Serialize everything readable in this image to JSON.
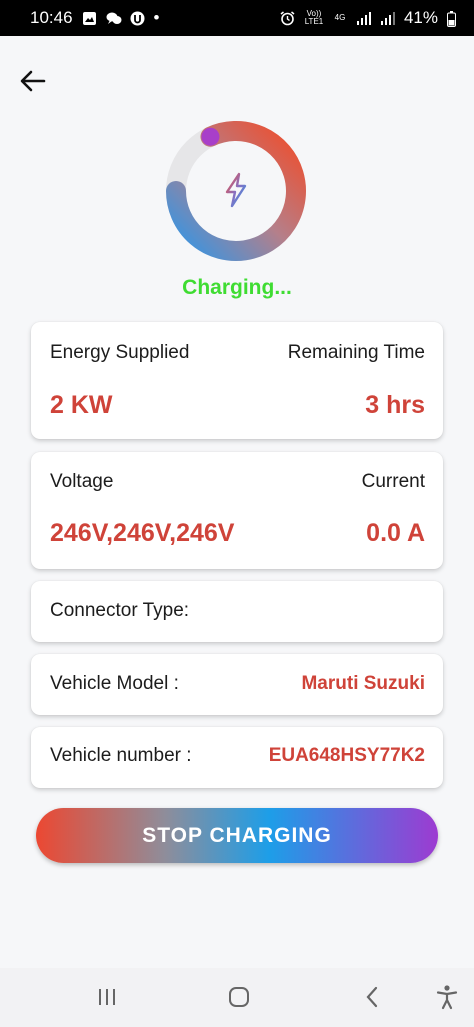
{
  "status_bar": {
    "time": "10:46",
    "dot": "•",
    "volte": "Vo)) LTE1",
    "network": "4G",
    "battery": "41%"
  },
  "header": {
    "back_icon": "arrow-left-icon"
  },
  "gauge": {
    "icon": "lightning-bolt-icon",
    "progress": 0.82
  },
  "status_text": "Charging...",
  "energy_card": {
    "energy_label": "Energy Supplied",
    "energy_value": "2 KW",
    "time_label": "Remaining Time",
    "time_value": "3 hrs"
  },
  "voltage_card": {
    "voltage_label": "Voltage",
    "voltage_value": "246V,246V,246V",
    "current_label": "Current",
    "current_value": "0.0 A"
  },
  "connector_card": {
    "label": "Connector Type:",
    "value": ""
  },
  "vehicle_model_card": {
    "label": "Vehicle Model :",
    "value": "Maruti Suzuki"
  },
  "vehicle_number_card": {
    "label": "Vehicle number :",
    "value": "EUA648HSY77K2"
  },
  "stop_button": {
    "label": "STOP CHARGING"
  },
  "colors": {
    "accent_red": "#cf4339",
    "charging_green": "#3fdc32"
  },
  "nav_bar": {
    "items": [
      "recent-apps-icon",
      "home-icon",
      "back-icon",
      "accessibility-icon"
    ]
  }
}
